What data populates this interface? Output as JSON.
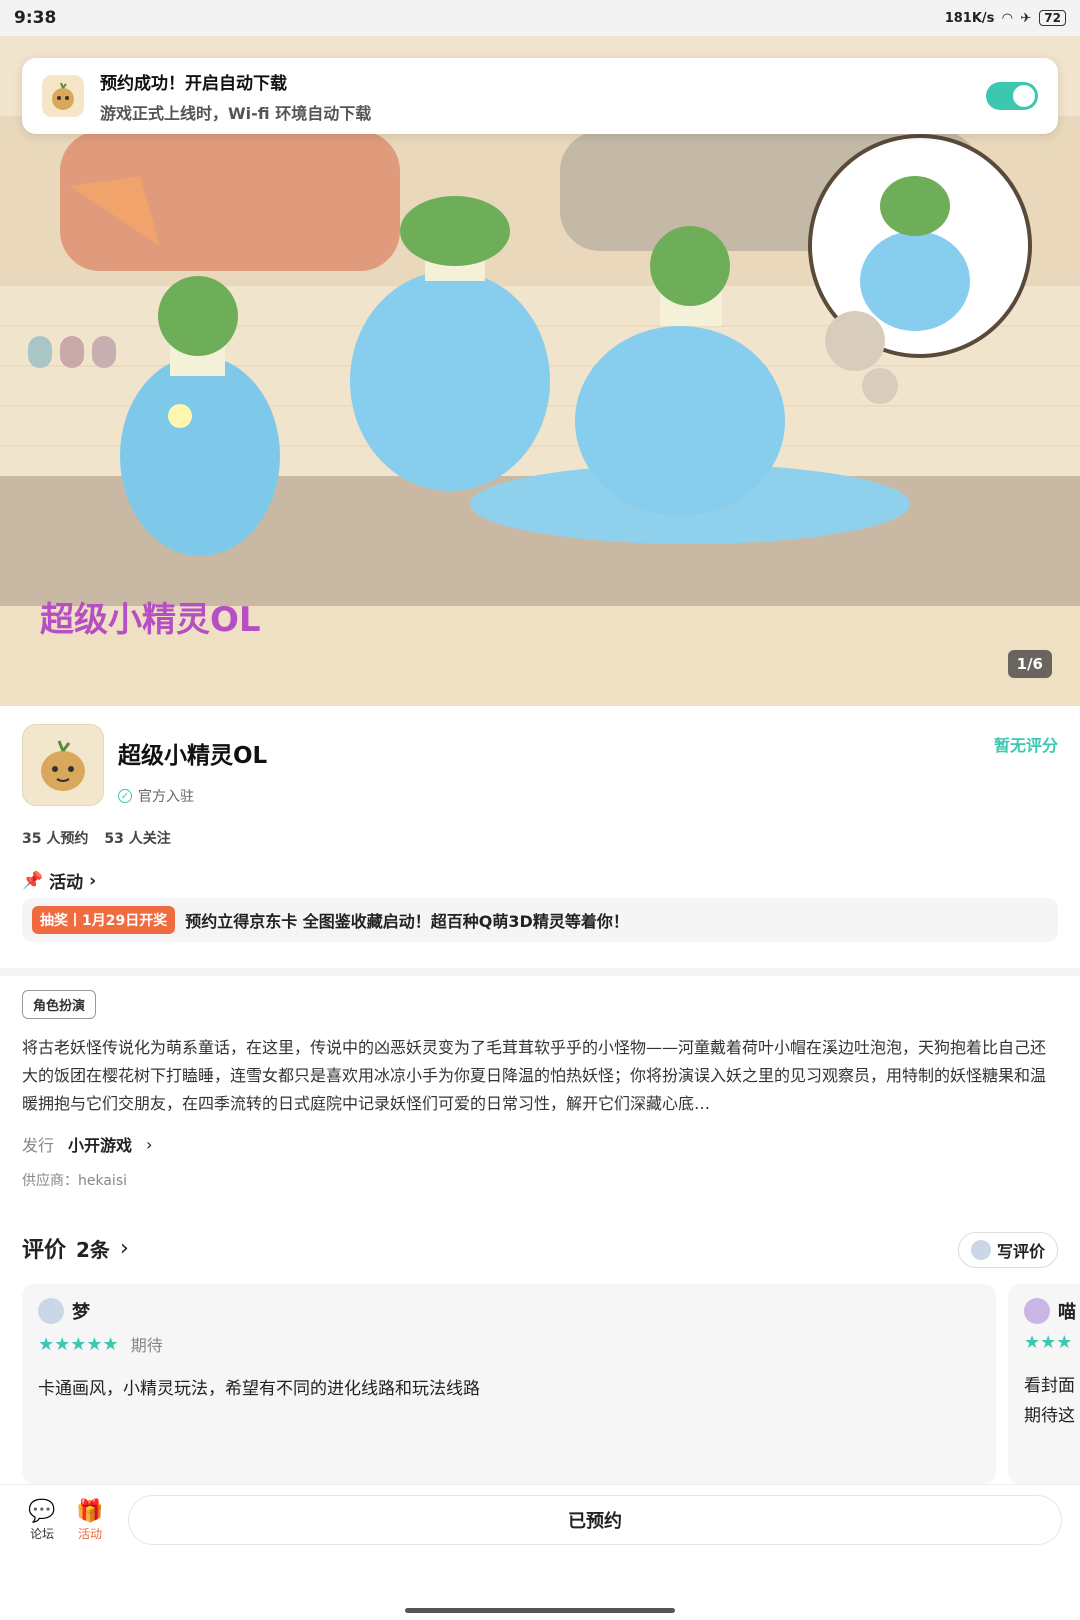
{
  "status_bar": {
    "time": "9:38",
    "network_speed": "181K/s",
    "battery": "72"
  },
  "notification": {
    "title": "预约成功！开启自动下载",
    "subtitle": "游戏正式上线时，Wi-fi 环境自动下载",
    "toggle_on": true
  },
  "hero": {
    "counter": "1/6",
    "logo_text": "超级小精灵OL"
  },
  "app": {
    "name": "超级小精灵OL",
    "official": "官方入驻",
    "rating": "暂无评分",
    "reservations": "35 人预约",
    "follows": "53 人关注"
  },
  "activity": {
    "header": "活动",
    "promo_tag": "抽奖丨1月29日开奖",
    "promo_text": "预约立得京东卡 全图鉴收藏启动！超百种Q萌3D精灵等着你！"
  },
  "description": {
    "genre": "角色扮演",
    "text": "将古老妖怪传说化为萌系童话，在这里，传说中的凶恶妖灵变为了毛茸茸软乎乎的小怪物——河童戴着荷叶小帽在溪边吐泡泡，天狗抱着比自己还大的饭团在樱花树下打瞌睡，连雪女都只是喜欢用冰凉小手为你夏日降温的怕热妖怪；你将扮演误入妖之里的见习观察员，用特制的妖怪糖果和温暖拥抱与它们交朋友，在四季流转的日式庭院中记录妖怪们可爱的日常习性，解开它们深藏心底…",
    "publisher_label": "发行",
    "publisher": "小开游戏",
    "supplier": "供应商：hekaisi"
  },
  "reviews": {
    "title": "评价",
    "count": "2条",
    "write_label": "写评价",
    "items": [
      {
        "user": "梦",
        "stars": "★★★★★",
        "tag": "期待",
        "text": "卡通画风，小精灵玩法，希望有不同的进化线路和玩法线路"
      },
      {
        "user": "喵",
        "stars": "★★★",
        "text_line1": "看封面",
        "text_line2": "期待这"
      }
    ]
  },
  "bottom_bar": {
    "forum": "论坛",
    "activity": "活动",
    "reserved": "已预约"
  },
  "colors": {
    "accent": "#3cc8b0",
    "promo": "#f26a3f"
  }
}
